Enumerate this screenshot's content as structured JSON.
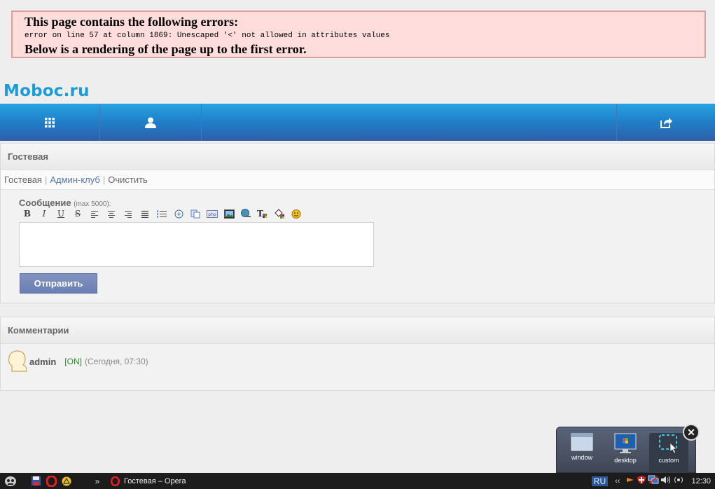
{
  "error": {
    "title": "This page contains the following errors:",
    "message": "error on line 57 at column 1869: Unescaped '<' not allowed in attributes values",
    "footer": "Below is a rendering of the page up to the first error."
  },
  "site": {
    "logo": "Moboc.ru"
  },
  "nav": {
    "items": [
      {
        "icon": "grid-icon"
      },
      {
        "icon": "user-icon"
      },
      {
        "icon": "share-icon"
      }
    ]
  },
  "guestbook": {
    "title": "Гостевая",
    "links": [
      "Гостевая",
      "Админ-клуб",
      "Очистить"
    ],
    "separator": "|",
    "message_label": "Сообщение",
    "message_limit": "(max 5000):",
    "toolbar": [
      {
        "name": "bold",
        "glyph": "B"
      },
      {
        "name": "italic",
        "glyph": "I"
      },
      {
        "name": "underline",
        "glyph": "U"
      },
      {
        "name": "strikethrough",
        "glyph": "S"
      },
      {
        "name": "align-left"
      },
      {
        "name": "align-center"
      },
      {
        "name": "align-right"
      },
      {
        "name": "align-justify"
      },
      {
        "name": "list"
      },
      {
        "name": "spoiler"
      },
      {
        "name": "copy"
      },
      {
        "name": "php"
      },
      {
        "name": "image"
      },
      {
        "name": "link"
      },
      {
        "name": "text-size"
      },
      {
        "name": "color"
      },
      {
        "name": "smiley"
      }
    ],
    "submit_label": "Отправить"
  },
  "comments": {
    "title": "Комментарии",
    "items": [
      {
        "user": "admin",
        "status": "[ON]",
        "time": "(Сегодня, 07:30)"
      }
    ]
  },
  "capture_popup": {
    "options": [
      "window",
      "desktop",
      "custom"
    ],
    "selected": "custom",
    "close": "✕"
  },
  "taskbar": {
    "task_title": "Гостевая – Opera",
    "expand": "»",
    "lang": "RU",
    "tray_expand": "‹‹",
    "clock": "12:30"
  }
}
